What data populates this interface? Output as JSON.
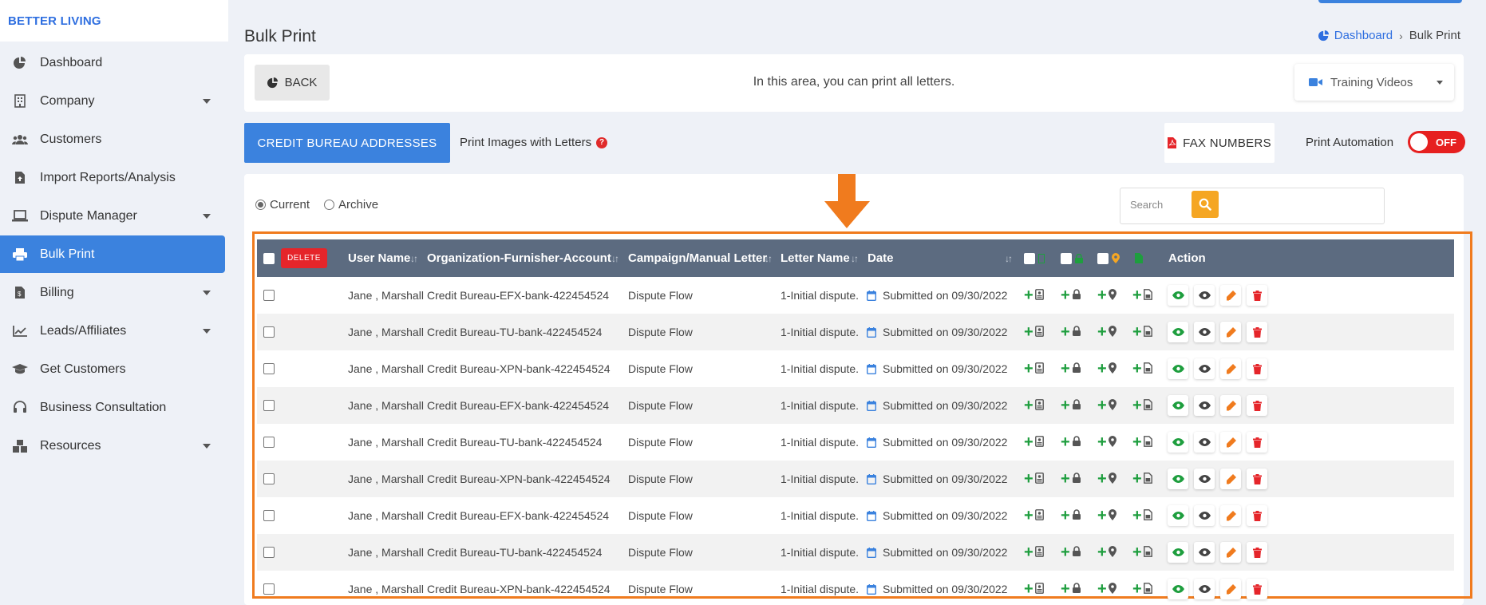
{
  "brand": "BETTER LIVING",
  "sidebar": {
    "items": [
      {
        "label": "Dashboard",
        "icon": "pie-chart-icon"
      },
      {
        "label": "Company",
        "icon": "building-icon"
      },
      {
        "label": "Customers",
        "icon": "users-icon"
      },
      {
        "label": "Import Reports/Analysis",
        "icon": "file-upload-icon"
      },
      {
        "label": "Dispute Manager",
        "icon": "laptop-icon"
      },
      {
        "label": "Bulk Print",
        "icon": "printer-icon"
      },
      {
        "label": "Billing",
        "icon": "invoice-icon"
      },
      {
        "label": "Leads/Affiliates",
        "icon": "chart-line-icon"
      },
      {
        "label": "Get Customers",
        "icon": "graduation-cap-icon"
      },
      {
        "label": "Business Consultation",
        "icon": "headset-icon"
      },
      {
        "label": "Resources",
        "icon": "boxes-icon"
      }
    ],
    "active": "Bulk Print",
    "accent": "#3b82de"
  },
  "page": {
    "title": "Bulk Print",
    "breadcrumb": {
      "home": "Dashboard",
      "current": "Bulk Print"
    }
  },
  "infobar": {
    "back_label": "BACK",
    "message": "In this area, you can print all letters.",
    "training_label": "Training Videos"
  },
  "actions": {
    "credit_bureau_label": "CREDIT BUREAU ADDRESSES",
    "print_images_label": "Print Images with Letters",
    "fax_label": "FAX NUMBERS",
    "automation_label": "Print Automation",
    "automation_state": "OFF"
  },
  "filter": {
    "current_label": "Current",
    "archive_label": "Archive",
    "selected": "Current",
    "search_placeholder": "Search"
  },
  "table": {
    "delete_label": "DELETE",
    "headers": {
      "user": "User Name",
      "org": "Organization-Furnisher-Account",
      "campaign": "Campaign/Manual Letter",
      "letter": "Letter Name",
      "date": "Date",
      "action": "Action"
    },
    "rows": [
      {
        "user": "Jane , Marshall",
        "org": "Credit Bureau-EFX-bank-422454524",
        "campaign": "Dispute Flow",
        "letter": "1-Initial dispute.",
        "date": "Submitted on 09/30/2022"
      },
      {
        "user": "Jane , Marshall",
        "org": "Credit Bureau-TU-bank-422454524",
        "campaign": "Dispute Flow",
        "letter": "1-Initial dispute.",
        "date": "Submitted on 09/30/2022"
      },
      {
        "user": "Jane , Marshall",
        "org": "Credit Bureau-XPN-bank-422454524",
        "campaign": "Dispute Flow",
        "letter": "1-Initial dispute.",
        "date": "Submitted on 09/30/2022"
      },
      {
        "user": "Jane , Marshall",
        "org": "Credit Bureau-EFX-bank-422454524",
        "campaign": "Dispute Flow",
        "letter": "1-Initial dispute.",
        "date": "Submitted on 09/30/2022"
      },
      {
        "user": "Jane , Marshall",
        "org": "Credit Bureau-TU-bank-422454524",
        "campaign": "Dispute Flow",
        "letter": "1-Initial dispute.",
        "date": "Submitted on 09/30/2022"
      },
      {
        "user": "Jane , Marshall",
        "org": "Credit Bureau-XPN-bank-422454524",
        "campaign": "Dispute Flow",
        "letter": "1-Initial dispute.",
        "date": "Submitted on 09/30/2022"
      },
      {
        "user": "Jane , Marshall",
        "org": "Credit Bureau-EFX-bank-422454524",
        "campaign": "Dispute Flow",
        "letter": "1-Initial dispute.",
        "date": "Submitted on 09/30/2022"
      },
      {
        "user": "Jane , Marshall",
        "org": "Credit Bureau-TU-bank-422454524",
        "campaign": "Dispute Flow",
        "letter": "1-Initial dispute.",
        "date": "Submitted on 09/30/2022"
      },
      {
        "user": "Jane , Marshall",
        "org": "Credit Bureau-XPN-bank-422454524",
        "campaign": "Dispute Flow",
        "letter": "1-Initial dispute.",
        "date": "Submitted on 09/30/2022"
      }
    ]
  },
  "colors": {
    "highlight": "#f07b1e",
    "header_bg": "#5c6b80",
    "green": "#1e9e3e",
    "red": "#e5252a",
    "search_btn": "#f5a623"
  }
}
